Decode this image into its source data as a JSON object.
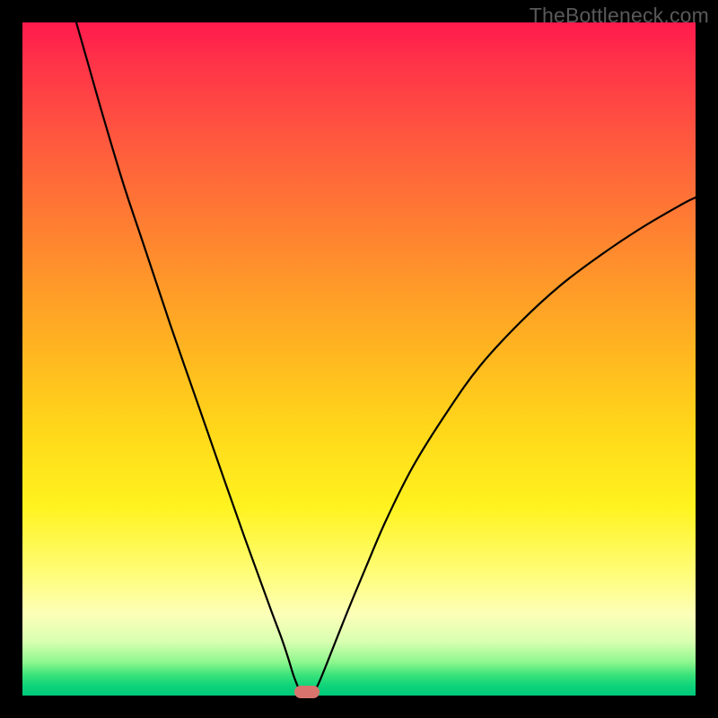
{
  "watermark": "TheBottleneck.com",
  "chart_data": {
    "type": "line",
    "title": "",
    "xlabel": "",
    "ylabel": "",
    "xlim": [
      0,
      100
    ],
    "ylim": [
      0,
      100
    ],
    "series": [
      {
        "name": "left-curve",
        "x": [
          8,
          10,
          12,
          15,
          18,
          22,
          26,
          30,
          33,
          35,
          37,
          38.5,
          39.5,
          40.2,
          40.8,
          41.3
        ],
        "values": [
          100,
          93,
          86,
          76,
          67,
          55,
          43.5,
          32,
          23.5,
          18,
          12.5,
          8.5,
          5.5,
          3.2,
          1.6,
          0.5
        ]
      },
      {
        "name": "right-curve",
        "x": [
          43.3,
          44,
          45,
          46.5,
          48.5,
          51,
          54,
          58,
          63,
          68,
          74,
          80,
          86,
          92,
          98,
          100
        ],
        "values": [
          0.5,
          1.8,
          4.2,
          8,
          13,
          19,
          26,
          34,
          42,
          49,
          55.5,
          61,
          65.5,
          69.5,
          73,
          74
        ]
      }
    ],
    "marker": {
      "x": 42.2,
      "y": 0.6
    },
    "background_gradient": {
      "top": "#ff1a4d",
      "mid": "#ffd61a",
      "bottom": "#00c97a"
    }
  }
}
